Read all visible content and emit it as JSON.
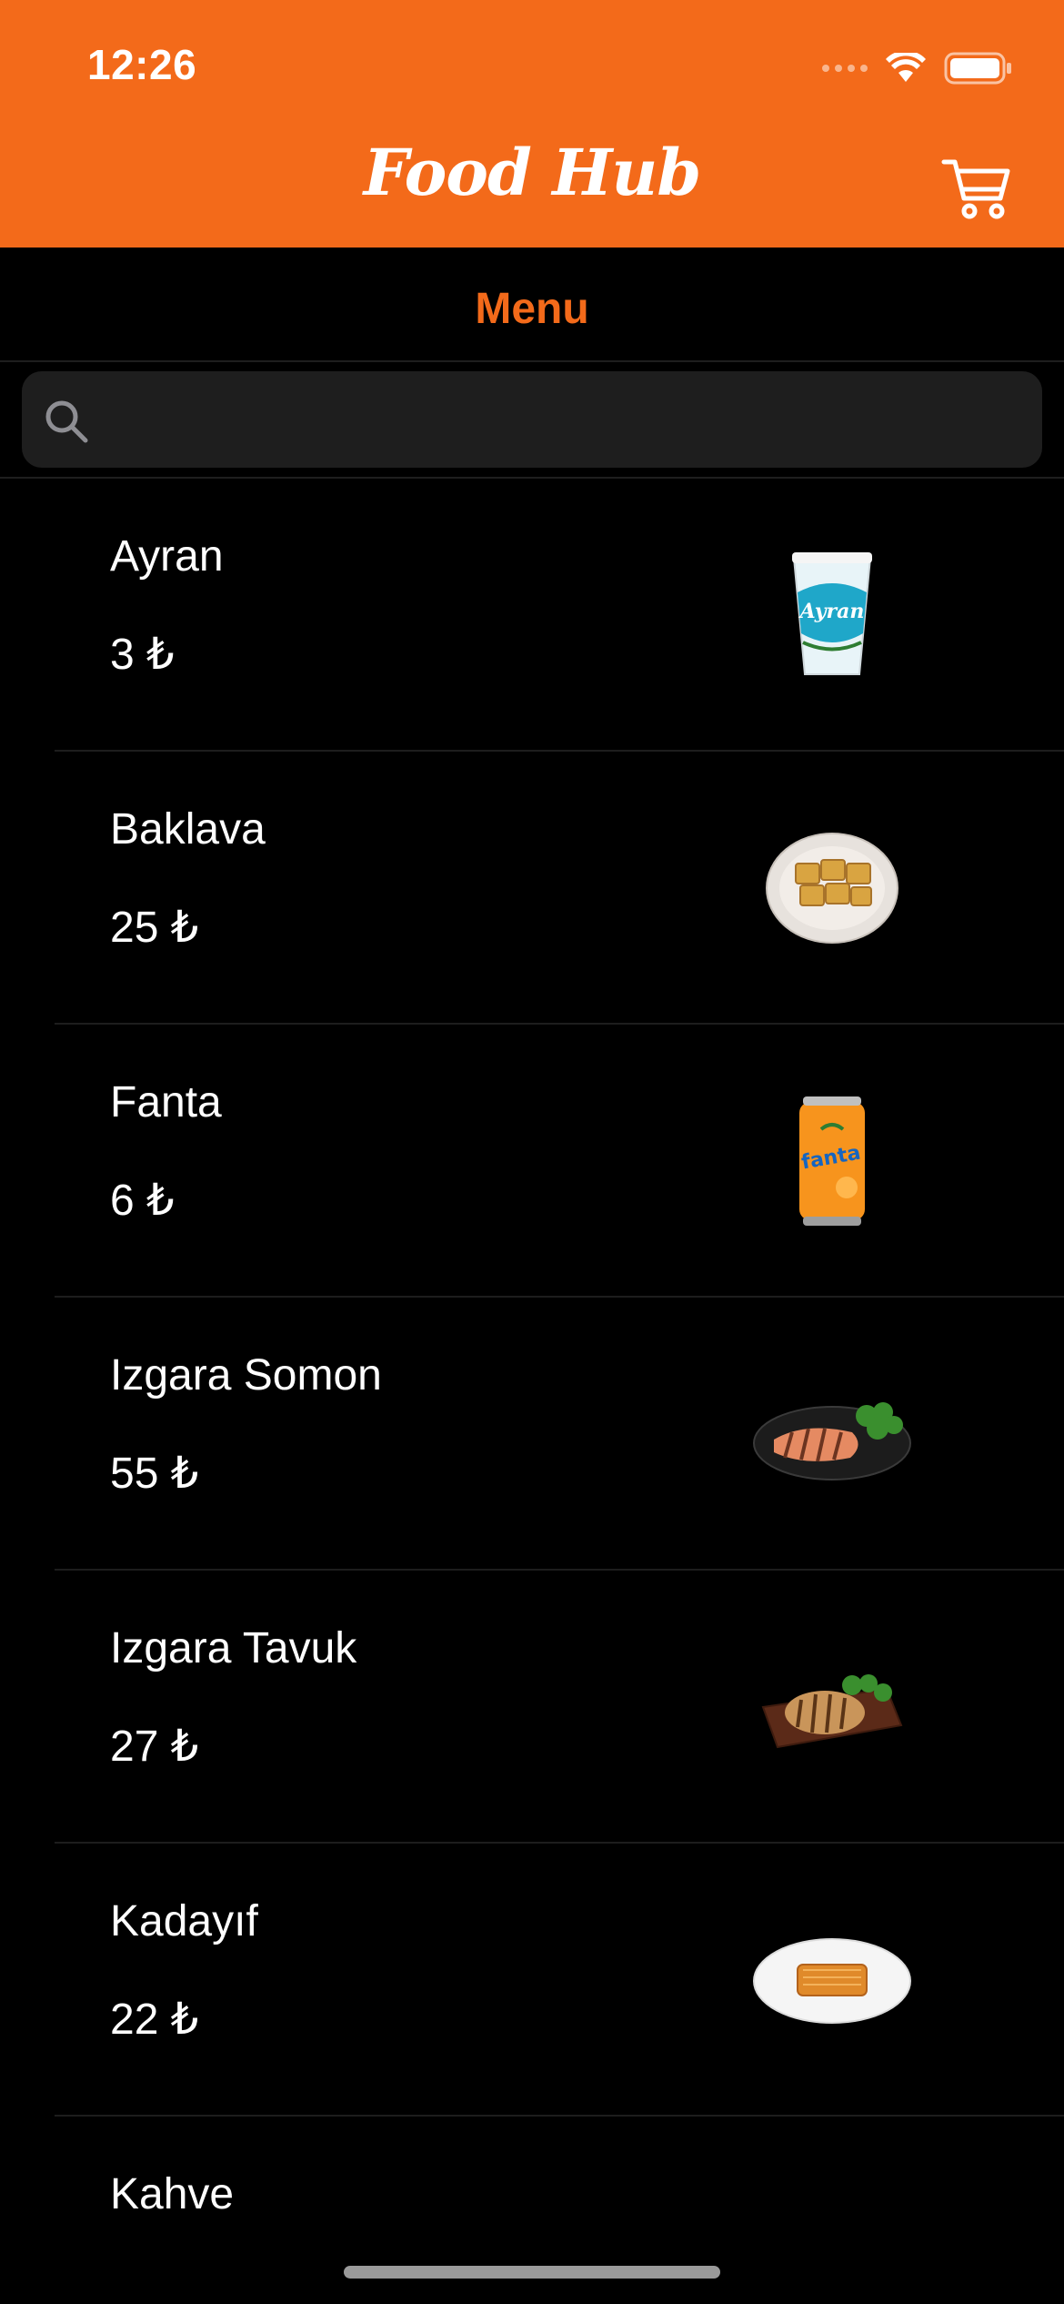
{
  "status_bar": {
    "time": "12:26"
  },
  "header": {
    "title": "Food Hub",
    "cart_icon": "cart-icon"
  },
  "menu": {
    "label": "Menu"
  },
  "search": {
    "value": "",
    "placeholder": ""
  },
  "items": [
    {
      "name": "Ayran",
      "price": "3 ₺",
      "image": "ayran-cup"
    },
    {
      "name": "Baklava",
      "price": "25 ₺",
      "image": "baklava-plate"
    },
    {
      "name": "Fanta",
      "price": "6 ₺",
      "image": "fanta-can"
    },
    {
      "name": "Izgara Somon",
      "price": "55 ₺",
      "image": "grilled-salmon"
    },
    {
      "name": "Izgara Tavuk",
      "price": "27 ₺",
      "image": "grilled-chicken"
    },
    {
      "name": "Kadayıf",
      "price": "22 ₺",
      "image": "kadayif-plate"
    },
    {
      "name": "Kahve",
      "price": "",
      "image": "coffee"
    }
  ],
  "colors": {
    "accent": "#F36A1A",
    "background": "#000000",
    "search_bg": "#1E1E1E"
  }
}
